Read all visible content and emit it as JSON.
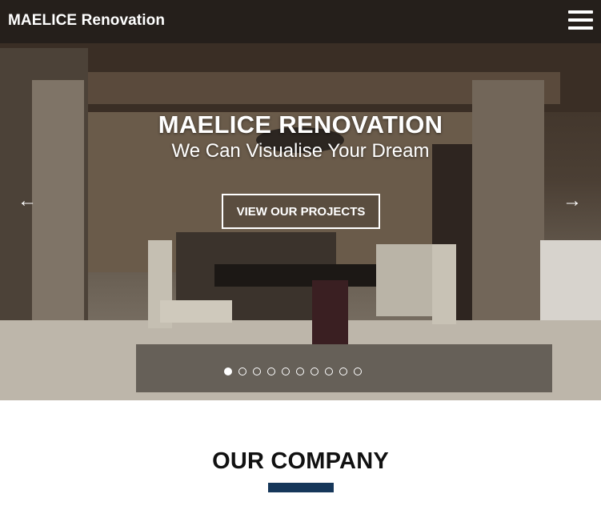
{
  "header": {
    "brand": "MAELICE Renovation",
    "menu_icon": "hamburger-menu-icon"
  },
  "hero": {
    "title": "MAELICE RENOVATION",
    "subtitle": "We Can Visualise Your Dream",
    "cta_label": "VIEW OUR PROJECTS",
    "prev_arrow": "←",
    "next_arrow": "→",
    "slide_count": 10,
    "active_slide": 1
  },
  "company_section": {
    "title": "OUR COMPANY",
    "accent_color": "#16375a"
  }
}
